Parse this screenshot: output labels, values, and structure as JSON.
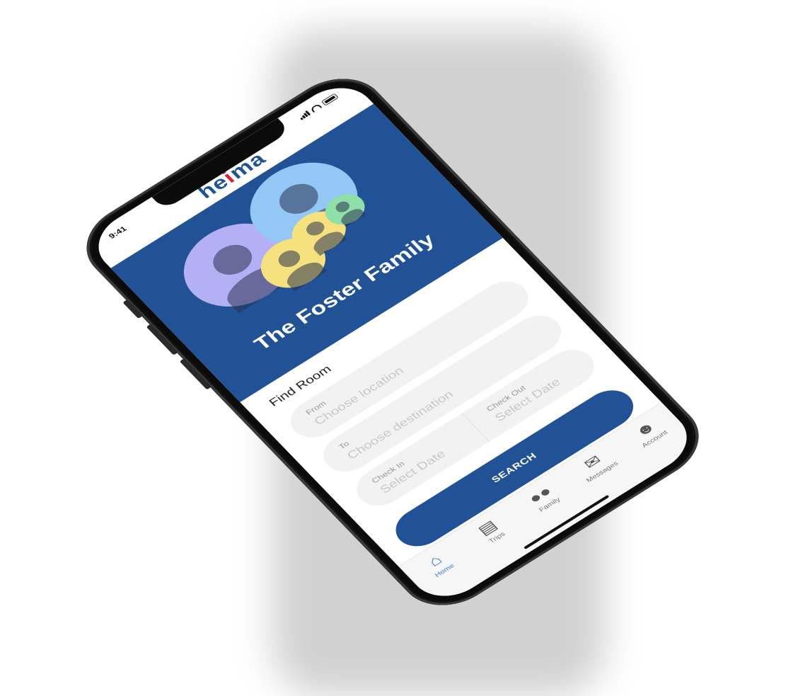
{
  "status": {
    "time": "9:41"
  },
  "brand": {
    "logo_a": "he",
    "logo_i": "i",
    "logo_b": "ma",
    "accent": "#215296",
    "logo_i_color": "#d3223a"
  },
  "header": {
    "title": "The Foster Family"
  },
  "search": {
    "section_title": "Find Room",
    "from": {
      "label": "From",
      "placeholder": "Choose location"
    },
    "to": {
      "label": "To",
      "placeholder": "Choose destination"
    },
    "check_in": {
      "label": "Check In",
      "placeholder": "Select Date"
    },
    "check_out": {
      "label": "Check Out",
      "placeholder": "Select Date"
    },
    "button": "SEARCH"
  },
  "tabs": [
    {
      "label": "Home",
      "icon": "home-icon",
      "active": true
    },
    {
      "label": "Trips",
      "icon": "trips-icon"
    },
    {
      "label": "Family",
      "icon": "family-icon"
    },
    {
      "label": "Messages",
      "icon": "messages-icon"
    },
    {
      "label": "Account",
      "icon": "account-icon"
    }
  ]
}
